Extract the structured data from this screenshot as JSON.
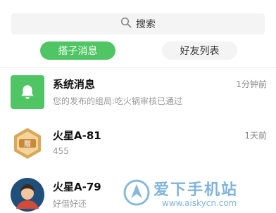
{
  "search": {
    "placeholder": "搜索",
    "icon": "search-icon"
  },
  "tabs": [
    {
      "label": "搭子消息",
      "active": true
    },
    {
      "label": "好友列表",
      "active": false
    }
  ],
  "messages": [
    {
      "name": "系统消息",
      "time": "1分钟前",
      "preview": "您的发布的组局:吃火锅审核已通过",
      "icon": "bell-icon"
    },
    {
      "name": "火星A-81",
      "time": "1天前",
      "preview": "455",
      "icon": "gift-badge-icon"
    },
    {
      "name": "火星A-79",
      "time": "",
      "preview": "好借好还",
      "icon": "user-avatar"
    }
  ],
  "watermark": {
    "title": "爱下手机站",
    "url": "www.aiskycn.com"
  },
  "colors": {
    "accent": "#4fc663",
    "badge": "#d9a85a"
  }
}
